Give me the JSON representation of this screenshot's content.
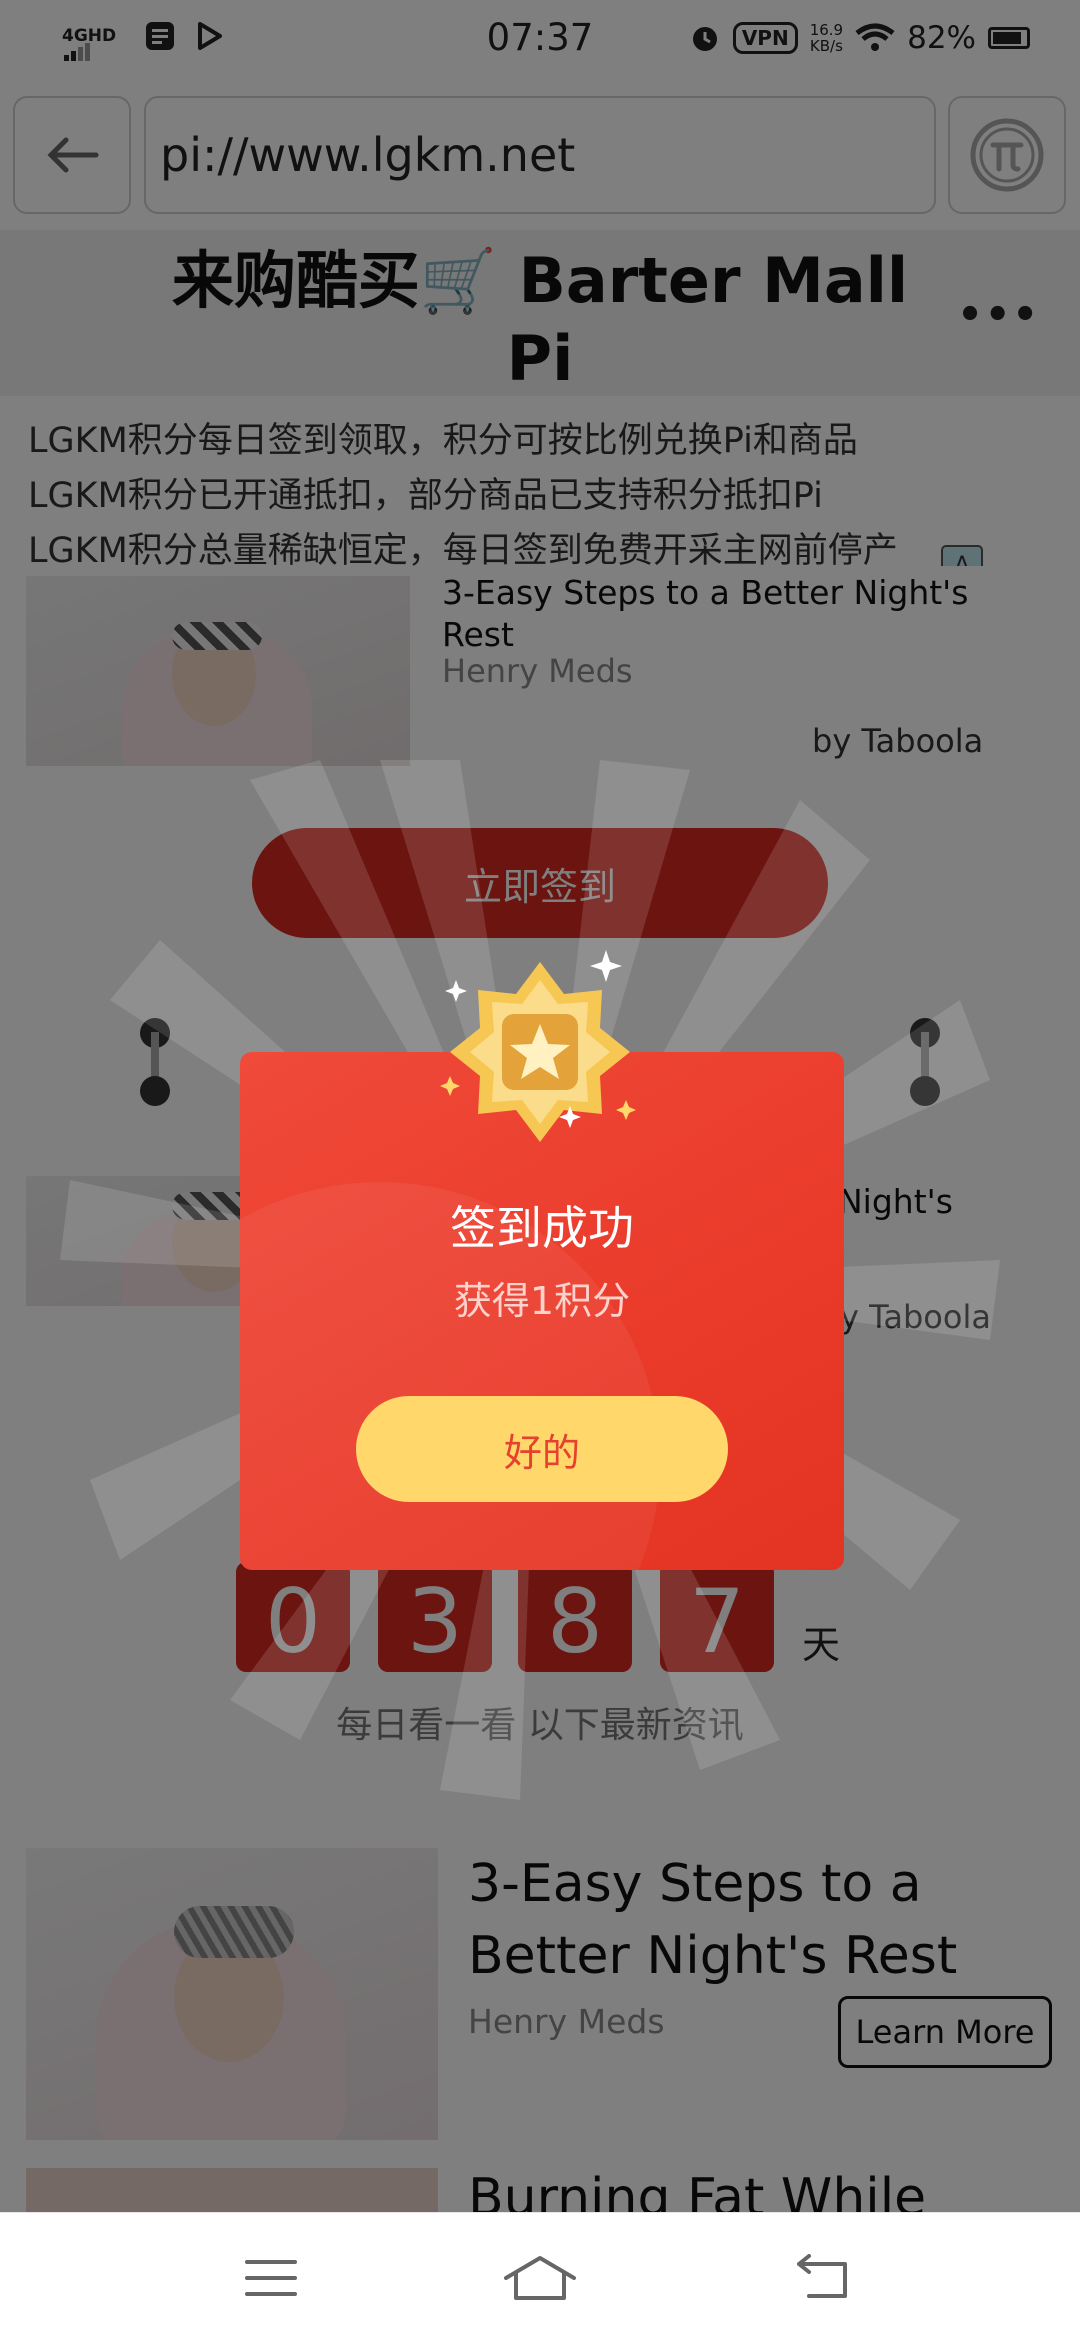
{
  "status_bar": {
    "network": "4GHD",
    "time": "07:37",
    "vpn": "VPN",
    "speed_value": "16.9",
    "speed_unit": "KB/s",
    "battery": "82%"
  },
  "browser": {
    "url": "pi://www.lgkm.net",
    "back_icon": "arrow-left-icon",
    "pi_icon": "pi-logo-icon"
  },
  "page": {
    "title_line1": "来购酷买🛒 Barter Mall",
    "title_line2": "Pi",
    "more_label": "•••"
  },
  "notices": [
    "LGKM积分每日签到领取，积分可按比例兑换Pi和商品",
    "LGKM积分已开通抵扣，部分商品已支持积分抵扣Pi",
    "LGKM积分总量稀缺恒定，每日签到免费开采主网前停产"
  ],
  "ad_top": {
    "title": "3-Easy Steps to a Better Night's Rest",
    "source": "Henry Meds",
    "by": "by Taboola"
  },
  "checkin_button": "立即签到",
  "ad_mid": {
    "title_visible": "Night's",
    "by_visible": "y Taboola"
  },
  "days_counter": {
    "digits": [
      "0",
      "3",
      "8",
      "7"
    ],
    "unit": "天"
  },
  "daily_label": "每日看一看 以下最新资讯",
  "ad_feed": {
    "title": "3-Easy Steps to a Better Night's Rest",
    "source": "Henry Meds",
    "cta": "Learn More",
    "next_title": "Burning Fat While"
  },
  "modal": {
    "title": "签到成功",
    "subtitle": "获得1积分",
    "ok_label": "好的",
    "colors": {
      "card": "#ea3a2a",
      "button": "#ffd76a",
      "button_text": "#e5412d"
    }
  }
}
